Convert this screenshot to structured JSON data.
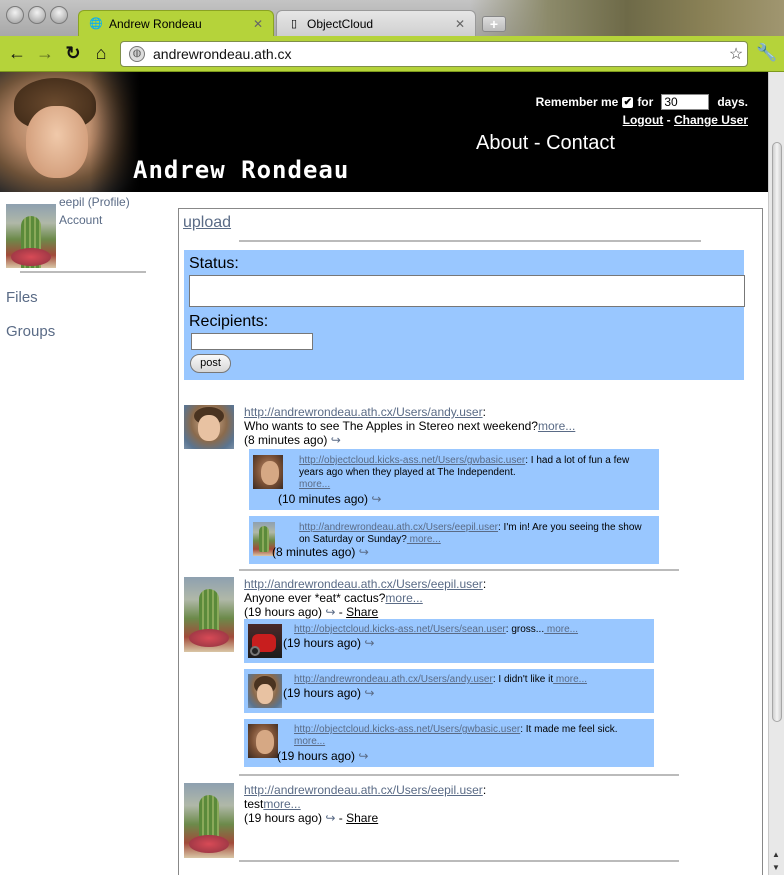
{
  "browser": {
    "tabs": [
      {
        "label": "Andrew Rondeau",
        "active": true
      },
      {
        "label": "ObjectCloud",
        "active": false
      }
    ],
    "url": "andrewrondeau.ath.cx"
  },
  "header": {
    "site_title": "Andrew Rondeau",
    "remember_label": "Remember me",
    "for_label": "for",
    "days_value": "30",
    "days_label": "days.",
    "logout": "Logout",
    "auth_sep": "-",
    "change_user": "Change User",
    "about": "About",
    "nav_sep": "-",
    "contact": "Contact"
  },
  "sidebar": {
    "profile": "eepil (Profile)",
    "account": "Account",
    "files": "Files",
    "groups": "Groups"
  },
  "composer": {
    "upload": "upload",
    "status_label": "Status:",
    "status_value": "",
    "recipients_label": "Recipients:",
    "recipients_value": "",
    "post_button": "post"
  },
  "feed": [
    {
      "url": "http://andrewrondeau.ath.cx/Users/andy.user",
      "text": "Who wants to see The Apples in Stereo next weekend?",
      "more": "more...",
      "time": "(8 minutes ago)",
      "share": "",
      "replies": [
        {
          "url": "http://objectcloud.kicks-ass.net/Users/gwbasic.user",
          "text": ": I had a lot of fun a few years ago when they played at The Independent.",
          "more": "more...",
          "time": "(10 minutes ago)"
        },
        {
          "url": "http://andrewrondeau.ath.cx/Users/eepil.user",
          "text": ": I'm in! Are you seeing the show on Saturday or Sunday?",
          "more": " more...",
          "time": "(8 minutes ago)"
        }
      ]
    },
    {
      "url": "http://andrewrondeau.ath.cx/Users/eepil.user",
      "text": "Anyone ever *eat* cactus?",
      "more": "more...",
      "time": "(19 hours ago)",
      "share": "Share",
      "replies": [
        {
          "url": "http://objectcloud.kicks-ass.net/Users/sean.user",
          "text": ": gross...",
          "more": " more...",
          "time": "(19 hours ago)"
        },
        {
          "url": "http://andrewrondeau.ath.cx/Users/andy.user",
          "text": ": I didn't like it",
          "more": " more...",
          "time": "(19 hours ago)"
        },
        {
          "url": "http://objectcloud.kicks-ass.net/Users/gwbasic.user",
          "text": ": It made me feel sick.",
          "more": " more...",
          "time": "(19 hours ago)"
        }
      ]
    },
    {
      "url": "http://andrewrondeau.ath.cx/Users/eepil.user",
      "text": "test",
      "more": "more...",
      "time": "(19 hours ago)",
      "share": "Share",
      "replies": []
    }
  ],
  "icons": {
    "reply": "reply-arrow-icon",
    "star": "bookmark-star-icon",
    "wrench": "wrench-icon",
    "globe": "globe-icon"
  },
  "colors": {
    "chrome_green": "#b5d33a",
    "status_blue": "#99c7ff",
    "link": "#5a6b86",
    "header_bg": "#000000"
  }
}
